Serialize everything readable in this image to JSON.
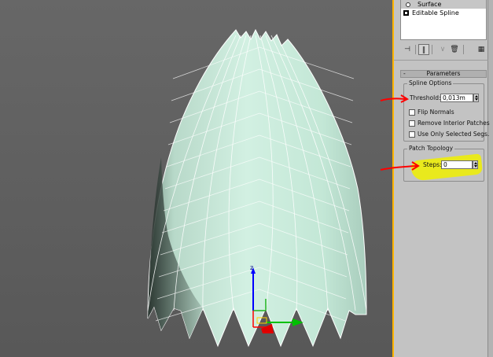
{
  "modifier_stack": {
    "items": [
      {
        "label": "Surface",
        "icon": "lightbulb-icon",
        "selected": true
      },
      {
        "label": "Editable Spline",
        "icon": "object-box-icon",
        "selected": false
      }
    ]
  },
  "toolbar": {
    "buttons": [
      {
        "name": "pin-stack-icon",
        "glyph": "⊣"
      },
      {
        "name": "show-end-result-icon",
        "glyph": "‖"
      },
      {
        "name": "make-unique-icon",
        "glyph": "∨"
      },
      {
        "name": "remove-modifier-icon",
        "glyph": "🗑"
      },
      {
        "name": "configure-modifier-sets-icon",
        "glyph": "▦"
      }
    ]
  },
  "parameters": {
    "rollout_title": "Parameters",
    "rollout_toggle": "-",
    "spline_options": {
      "title": "Spline Options",
      "threshold_label": "Threshold:",
      "threshold_value": "0,013m",
      "checkboxes": [
        {
          "label": "Flip Normals",
          "checked": false
        },
        {
          "label": "Remove Interior Patches",
          "checked": false
        },
        {
          "label": "Use Only Selected Segs.",
          "checked": false
        }
      ]
    },
    "patch_topology": {
      "title": "Patch Topology",
      "steps_label": "Steps:",
      "steps_value": "0"
    }
  },
  "colors": {
    "viewport_border": "#ffb400",
    "mesh_fill": "#bfe6d4",
    "annotation_arrow": "#ff0000",
    "annotation_highlight": "#f0f000",
    "gizmo_x": "#ff0000",
    "gizmo_y": "#00c000",
    "gizmo_z": "#0000ff"
  },
  "gizmo": {
    "z_label": "z"
  }
}
